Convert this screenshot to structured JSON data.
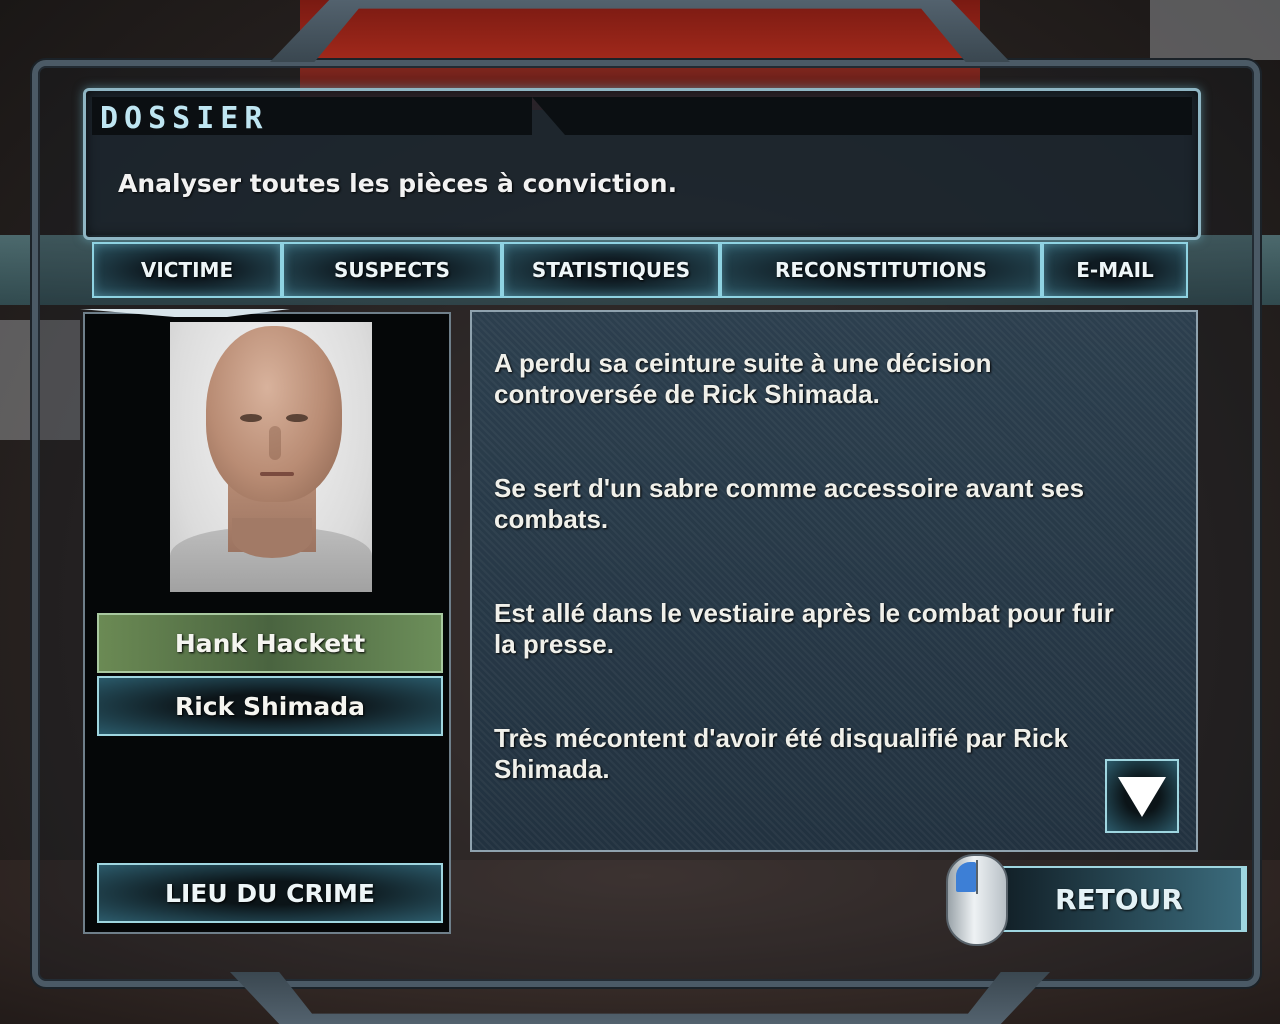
{
  "dossier": {
    "title": "DOSSIER",
    "instruction": "Analyser toutes les pièces à conviction."
  },
  "tabs": [
    {
      "label": "VICTIME"
    },
    {
      "label": "SUSPECTS"
    },
    {
      "label": "STATISTIQUES"
    },
    {
      "label": "RECONSTITUTIONS"
    },
    {
      "label": "E-MAIL"
    }
  ],
  "suspects": {
    "selected": "Hank Hackett",
    "names": [
      "Hank Hackett",
      "Rick Shimada"
    ],
    "portrait_icon": "suspect-portrait"
  },
  "info": {
    "items": [
      "A perdu sa ceinture suite à une décision controversée de Rick Shimada.",
      "Se sert d'un sabre comme accessoire avant ses combats.",
      "Est allé dans le vestiaire après le combat pour fuir la presse.",
      "Très mécontent d'avoir été disqualifié par Rick Shimada."
    ],
    "scroll_icon": "arrow-down-icon"
  },
  "buttons": {
    "crime_scene": "LIEU DU CRIME",
    "back": "RETOUR",
    "mouse_icon": "mouse-left-click-icon"
  },
  "colors": {
    "accent": "#8fd3e2",
    "selected": "#5f7d4e",
    "panel": "#263848"
  }
}
